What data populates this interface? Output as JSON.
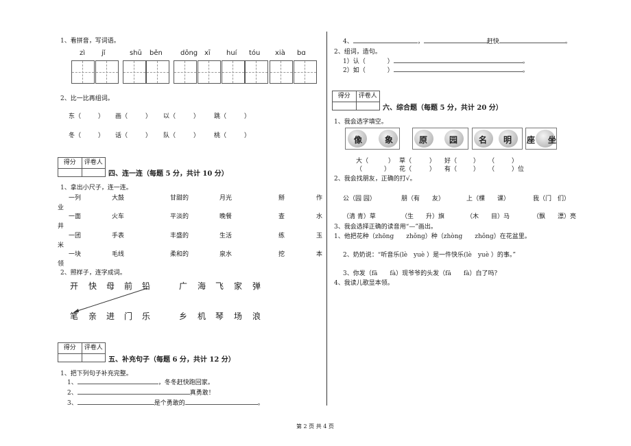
{
  "left": {
    "q1": {
      "title": "1、看拼音，写词语。",
      "pinyin": [
        "zì",
        "jǐ",
        "shū",
        "běn",
        "dōng",
        "xī",
        "huí",
        "tóu",
        "xià",
        "bɑ"
      ]
    },
    "q2": {
      "title": "2、比一比再组词。",
      "row1": [
        "东（",
        "）",
        "画（",
        "）",
        "以（",
        "）",
        "跳（",
        "）"
      ],
      "row2": [
        "冬（",
        "）",
        "话（",
        "）",
        "队（",
        "）",
        "桃（",
        "）"
      ]
    },
    "sec4": {
      "score": "得分",
      "grader": "评卷人",
      "title": "四、连一连（每题 5 分，共计 10 分）",
      "q1_title": "1、拿出小尺子，连一连。",
      "rows": [
        [
          "一列",
          "大鼓",
          "甘甜的",
          "月光",
          "掰",
          "作"
        ],
        [
          "一面",
          "火车",
          "平淡的",
          "晚餐",
          "查",
          "水"
        ],
        [
          "一团",
          "手表",
          "丰盛的",
          "生活",
          "练",
          "玉"
        ],
        [
          "一块",
          "毛线",
          "柔和的",
          "泉水",
          "挖",
          "本"
        ]
      ],
      "row_tails": [
        "业",
        "井",
        "米",
        "领"
      ],
      "q2_title": "2、照样子，连字成词。",
      "top_chars": [
        "开",
        "快",
        "母",
        "前",
        "铅",
        "广",
        "海",
        "飞",
        "家",
        "弹"
      ],
      "bottom_chars": [
        "笔",
        "亲",
        "进",
        "门",
        "乐",
        "乡",
        "机",
        "琴",
        "场",
        "浪"
      ]
    },
    "sec5": {
      "score": "得分",
      "grader": "评卷人",
      "title": "五、补充句子（每题 6 分，共计 12 分）",
      "q1_title": "1、把下列句子补充完整。",
      "lines": [
        {
          "num": "1、",
          "tail": "，冬冬赶快跑回家。"
        },
        {
          "num": "2、",
          "tail": "真勇敢！"
        },
        {
          "num": "3、",
          "mid": "是个勇敢的",
          "tail": "。"
        }
      ]
    }
  },
  "right": {
    "q4": {
      "num": "4、",
      "mid": "，",
      "tail": "赶快",
      "end": "。"
    },
    "q2": {
      "title": "2、组词，造句。",
      "l1": "1）认（",
      "l1b": "）",
      "l2": "2）如（",
      "l2b": "）",
      "end": "。"
    },
    "sec6": {
      "score": "得分",
      "grader": "评卷人",
      "title": "六、综合题（每题 5 分，共计 20 分）",
      "q1_title": "1、我会选字填空。",
      "apples": [
        "像",
        "象",
        "原",
        "园",
        "名",
        "明",
        "座",
        "坐"
      ],
      "fill1": [
        "大（",
        "）",
        "草（",
        "）",
        "好（",
        "）",
        "（",
        "）"
      ],
      "fill2": [
        "（",
        "）",
        "花（",
        "）",
        "有（",
        "）",
        "（",
        "）位"
      ],
      "q2_title": "2、我会找朋友，正确的打√。",
      "pairs1": [
        "公（园 园）",
        "朋（有　　友）",
        "上（棵　　课）",
        "我（门　们）"
      ],
      "pairs2": [
        "（清 青）草",
        "（生　　升）旗",
        "（木　　目）马",
        "（飘　　漂）亮"
      ],
      "q3_title": "3、我会选择正确的读音用“—”画出。",
      "s1": "1、他把花种（zhōng　　zhǒng）种（zhòng　　zhǒng）在花盆里。",
      "s2": "2、奶奶说：“听音乐(lè　yuè ）是一件快乐(lè　yuè ）的事。”",
      "s3": "3、你发（fā　　fà）现爷爷的头发（fā　　fà）白了吗？",
      "q4_title": "4、我读儿歌显本领。"
    }
  },
  "footer": "第 2 页 共 4 页"
}
